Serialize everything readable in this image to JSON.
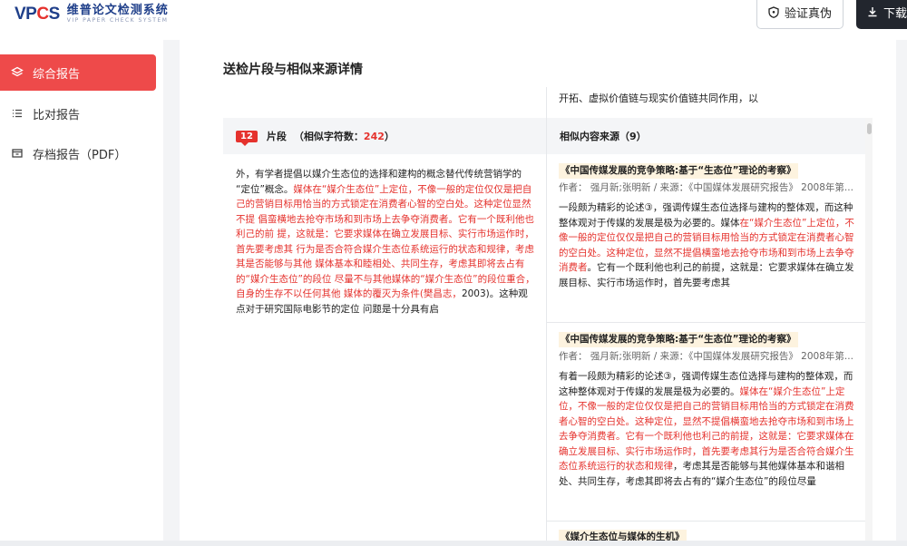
{
  "header": {
    "logo_mark_1": "VP",
    "logo_mark_2": "C",
    "logo_mark_3": "S",
    "logo_title": "维普论文检测系统",
    "logo_subtitle": "VIP PAPER CHECK SYSTEM",
    "verify_label": "验证真伪",
    "download_label": "下载"
  },
  "sidebar": {
    "items": [
      {
        "label": "综合报告",
        "active": true
      },
      {
        "label": "比对报告",
        "active": false
      },
      {
        "label": "存档报告（PDF）",
        "active": false
      }
    ]
  },
  "main": {
    "title": "送检片段与相似来源详情",
    "top_snippet": "开拓、虚拟价值链与现实价值链共同作用，以",
    "fragment_header": {
      "number": "12",
      "label": "片段",
      "count_prefix": "（相似字符数：",
      "count": "242",
      "count_suffix": "）"
    },
    "sources_header": "相似内容来源（9）",
    "fragment": {
      "t1": "外，有学者提倡以媒介生态位的选择和建构的概念替代传统营销学的 “定位”概念。",
      "t2": "媒体在“媒介生态位”上定位，不像一般的定位仅仅是把自 己的营销目标用恰当的方式锁定在消费者心智的空白处。这种定位显然不提 倡蛮横地去抢夺市场和到市场上去争夺消费者。它有一个既利他也利己的前 提，这就是：它要求媒体在确立发展目标、实行市场运作时，首先要考虑其 行为是否合符合媒介生态位系统运行的状态和规律，考虑其是否能够与其他 媒体基本和睦相处、共同生存，考虑其即将去占有的“媒介生态位”的段位 尽量不与其他媒体的“媒介生态位”的段位重合，自身的生存不以任何其他 媒体的覆灭为条件(樊昌志，",
      "t3": "2003)。这种观点对于研究国际电影节的定位 问题是十分具有启"
    },
    "sources": [
      {
        "title": "《中国传媒发展的竞争策略:基于“生态位”理论的考察》",
        "meta": "作者：   强月新;张明新 / 来源：《中国媒体发展研究报告》  2008年第...",
        "t1": "一段颇为精彩的论述③，强调传媒生态位选择与建构的整体观，而这种整体观对于传媒的发展是极为必要的。媒体",
        "t2": "在“媒介生态位”上定位，不像一般的定位仅仅是把自己的营销目标用恰当的方式锁定在消费者心智的空白处。这种定位，显然不提倡横蛮地去抢夺市场和到市场上去争夺消费者",
        "t3": "。它有一个既利他也利己的前提，这就是：它要求媒体在确立发展目标、实行市场运作时，首先要考虑其"
      },
      {
        "title": "《中国传媒发展的竞争策略:基于“生态位”理论的考察》",
        "meta": "作者：   强月新;张明新 / 来源：《中国媒体发展研究报告》  2008年第...",
        "t1": "有着一段颇为精彩的论述③，强调传媒生态位选择与建构的整体观，而这种整体观对于传媒的发展是极为必要的。",
        "t2": "媒体在“媒介生态位”上定位，不像一般的定位仅仅是把自己的营销目标用恰当的方式锁定在消费者心智的空白处。这种定位，显然不提倡横蛮地去抢夺市场和到市场上去争夺消费者。它有一个既利他也利己的前提，这就是：它要求媒体在确立发展目标、实行市场运作时，首先要考虑其行为是否合符合媒介生态位系统运行的状态和规律",
        "t3": "，考虑其是否能够与其他媒体基本和谐相处、共同生存，考虑其即将去占有的“媒介生态位”的段位尽量"
      },
      {
        "title": "《媒介生态位与媒体的生机》"
      }
    ]
  },
  "colors": {
    "accent": "#ee4a4a",
    "highlight": "#e5322d",
    "brand_blue": "#1f3f8a"
  }
}
